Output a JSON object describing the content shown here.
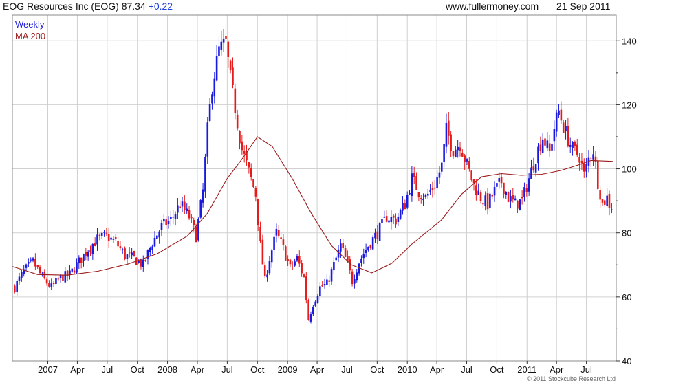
{
  "header": {
    "ticker_name": "EOG Resources Inc (EOG)",
    "price": "87.34",
    "change": "+0.22",
    "site": "www.fullermoney.com",
    "date": "21 Sep 2011"
  },
  "copyright": "© 2011 Stockcube Research Ltd",
  "colors": {
    "up": "#1a1adf",
    "down": "#e61c1c",
    "ma": "#9b1c1c",
    "grid": "#d0d0d0",
    "frame": "#888888"
  },
  "chart_data": {
    "type": "candlestick",
    "series": [
      {
        "name": "Weekly",
        "color": "#1a1adf"
      },
      {
        "name": "MA 200",
        "color": "#9b1c1c"
      }
    ],
    "ylim": [
      40,
      148
    ],
    "yticks": [
      40,
      60,
      80,
      100,
      120,
      140
    ],
    "xlim": [
      "2006-09-15",
      "2011-09-30"
    ],
    "xticks": [
      {
        "date": "2007-01-01",
        "label": "2007"
      },
      {
        "date": "2007-04-01",
        "label": "Apr"
      },
      {
        "date": "2007-07-01",
        "label": "Jul"
      },
      {
        "date": "2007-10-01",
        "label": "Oct"
      },
      {
        "date": "2008-01-01",
        "label": "2008"
      },
      {
        "date": "2008-04-01",
        "label": "Apr"
      },
      {
        "date": "2008-07-01",
        "label": "Jul"
      },
      {
        "date": "2008-10-01",
        "label": "Oct"
      },
      {
        "date": "2009-01-01",
        "label": "2009"
      },
      {
        "date": "2009-04-01",
        "label": "Apr"
      },
      {
        "date": "2009-07-01",
        "label": "Jul"
      },
      {
        "date": "2009-10-01",
        "label": "Oct"
      },
      {
        "date": "2010-01-01",
        "label": "2010"
      },
      {
        "date": "2010-04-01",
        "label": "Apr"
      },
      {
        "date": "2010-07-01",
        "label": "Jul"
      },
      {
        "date": "2010-10-01",
        "label": "Oct"
      },
      {
        "date": "2011-01-01",
        "label": "2011"
      },
      {
        "date": "2011-04-01",
        "label": "Apr"
      },
      {
        "date": "2011-07-01",
        "label": "Jul"
      }
    ],
    "weekly_close_path": [
      [
        "2006-09-22",
        63
      ],
      [
        "2006-10-20",
        68
      ],
      [
        "2006-11-17",
        71
      ],
      [
        "2006-12-15",
        66
      ],
      [
        "2007-01-12",
        63
      ],
      [
        "2007-02-09",
        66
      ],
      [
        "2007-03-09",
        67
      ],
      [
        "2007-04-06",
        71
      ],
      [
        "2007-05-04",
        75
      ],
      [
        "2007-06-01",
        78
      ],
      [
        "2007-06-29",
        79
      ],
      [
        "2007-07-27",
        77
      ],
      [
        "2007-08-24",
        73
      ],
      [
        "2007-09-21",
        72
      ],
      [
        "2007-10-19",
        70
      ],
      [
        "2007-11-16",
        77
      ],
      [
        "2007-12-14",
        82
      ],
      [
        "2008-01-11",
        84
      ],
      [
        "2008-02-08",
        89
      ],
      [
        "2008-03-07",
        85
      ],
      [
        "2008-03-28",
        79
      ],
      [
        "2008-04-18",
        93
      ],
      [
        "2008-05-02",
        112
      ],
      [
        "2008-05-16",
        126
      ],
      [
        "2008-06-06",
        137
      ],
      [
        "2008-06-27",
        139
      ],
      [
        "2008-07-11",
        128
      ],
      [
        "2008-07-25",
        119
      ],
      [
        "2008-08-15",
        106
      ],
      [
        "2008-09-05",
        99
      ],
      [
        "2008-09-26",
        92
      ],
      [
        "2008-10-10",
        76
      ],
      [
        "2008-10-24",
        65
      ],
      [
        "2008-11-07",
        72
      ],
      [
        "2008-11-28",
        80
      ],
      [
        "2008-12-19",
        75
      ],
      [
        "2009-01-09",
        69
      ],
      [
        "2009-01-30",
        72
      ],
      [
        "2009-02-20",
        66
      ],
      [
        "2009-03-06",
        53
      ],
      [
        "2009-03-20",
        58
      ],
      [
        "2009-04-10",
        63
      ],
      [
        "2009-05-01",
        64
      ],
      [
        "2009-05-22",
        70
      ],
      [
        "2009-06-12",
        76
      ],
      [
        "2009-07-03",
        70
      ],
      [
        "2009-07-17",
        65
      ],
      [
        "2009-08-07",
        71
      ],
      [
        "2009-09-04",
        76
      ],
      [
        "2009-10-02",
        80
      ],
      [
        "2009-10-30",
        85
      ],
      [
        "2009-11-27",
        84
      ],
      [
        "2009-12-25",
        89
      ],
      [
        "2010-01-15",
        97
      ],
      [
        "2010-02-05",
        93
      ],
      [
        "2010-02-26",
        91
      ],
      [
        "2010-03-26",
        95
      ],
      [
        "2010-04-16",
        101
      ],
      [
        "2010-04-30",
        112
      ],
      [
        "2010-05-21",
        106
      ],
      [
        "2010-06-11",
        108
      ],
      [
        "2010-07-02",
        101
      ],
      [
        "2010-07-23",
        95
      ],
      [
        "2010-08-13",
        91
      ],
      [
        "2010-09-03",
        89
      ],
      [
        "2010-09-24",
        93
      ],
      [
        "2010-10-15",
        96
      ],
      [
        "2010-11-05",
        91
      ],
      [
        "2010-11-26",
        89
      ],
      [
        "2010-12-17",
        90
      ],
      [
        "2011-01-07",
        97
      ],
      [
        "2011-01-28",
        104
      ],
      [
        "2011-02-18",
        110
      ],
      [
        "2011-03-11",
        105
      ],
      [
        "2011-03-25",
        113
      ],
      [
        "2011-04-08",
        118
      ],
      [
        "2011-04-29",
        111
      ],
      [
        "2011-05-20",
        106
      ],
      [
        "2011-06-10",
        104
      ],
      [
        "2011-06-24",
        98
      ],
      [
        "2011-07-08",
        103
      ],
      [
        "2011-07-22",
        106
      ],
      [
        "2011-08-05",
        96
      ],
      [
        "2011-08-19",
        89
      ],
      [
        "2011-09-02",
        91
      ],
      [
        "2011-09-16",
        87
      ]
    ],
    "ma200": [
      [
        "2006-09-15",
        69.5
      ],
      [
        "2006-12-01",
        67.0
      ],
      [
        "2007-03-01",
        66.8
      ],
      [
        "2007-06-01",
        68.0
      ],
      [
        "2007-09-01",
        70.2
      ],
      [
        "2007-12-01",
        73.5
      ],
      [
        "2008-03-01",
        79.0
      ],
      [
        "2008-05-01",
        86.0
      ],
      [
        "2008-07-01",
        97.0
      ],
      [
        "2008-08-15",
        103.0
      ],
      [
        "2008-10-01",
        110.0
      ],
      [
        "2008-11-15",
        107.0
      ],
      [
        "2009-01-15",
        97.0
      ],
      [
        "2009-03-15",
        86.0
      ],
      [
        "2009-05-15",
        76.0
      ],
      [
        "2009-07-15",
        70.0
      ],
      [
        "2009-09-15",
        67.5
      ],
      [
        "2009-11-15",
        70.5
      ],
      [
        "2010-01-15",
        76.5
      ],
      [
        "2010-04-15",
        84.0
      ],
      [
        "2010-06-15",
        92.0
      ],
      [
        "2010-08-15",
        97.5
      ],
      [
        "2010-10-15",
        98.5
      ],
      [
        "2010-12-15",
        98.0
      ],
      [
        "2011-02-15",
        98.3
      ],
      [
        "2011-04-15",
        99.5
      ],
      [
        "2011-06-15",
        101.5
      ],
      [
        "2011-07-15",
        102.6
      ],
      [
        "2011-09-21",
        102.3
      ]
    ],
    "last_close": 87.34
  }
}
